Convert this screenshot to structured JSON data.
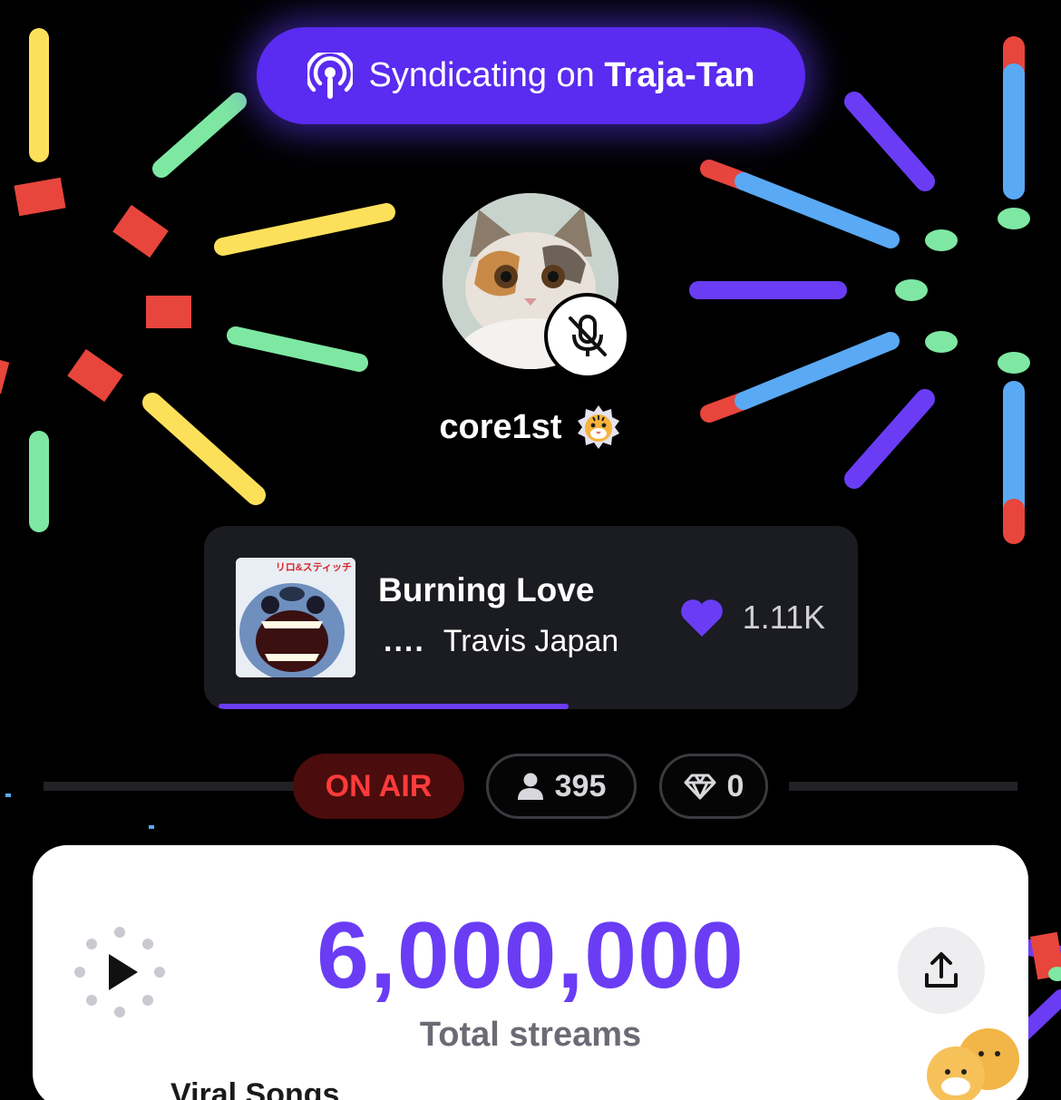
{
  "header": {
    "syndicating_prefix": "Syndicating on",
    "syndicating_channel": "Traja-Tan",
    "icon": "podcast-broadcast-icon",
    "accent": "#5a2bf0"
  },
  "host": {
    "username": "core1st",
    "mic_state_icon": "mic-muted-icon",
    "badge_icon": "tiger-face-icon"
  },
  "now_playing": {
    "title": "Burning Love",
    "artist": "Travis Japan",
    "eq_glyph": "....",
    "likes": "1.11K",
    "progress": 0.56,
    "cover_text": "リロ&スティッチ"
  },
  "status": {
    "on_air_label": "ON AIR",
    "listeners": "395",
    "gems": "0"
  },
  "totals": {
    "value": "6,000,000",
    "label": "Total streams"
  },
  "behind_text": "Viral Songs",
  "colors": {
    "purple": "#6a3df5",
    "red": "#e8453c",
    "green": "#7ee8a2",
    "yellow": "#fde05a",
    "blue": "#5aa9f5",
    "violet": "#6a3df5"
  }
}
